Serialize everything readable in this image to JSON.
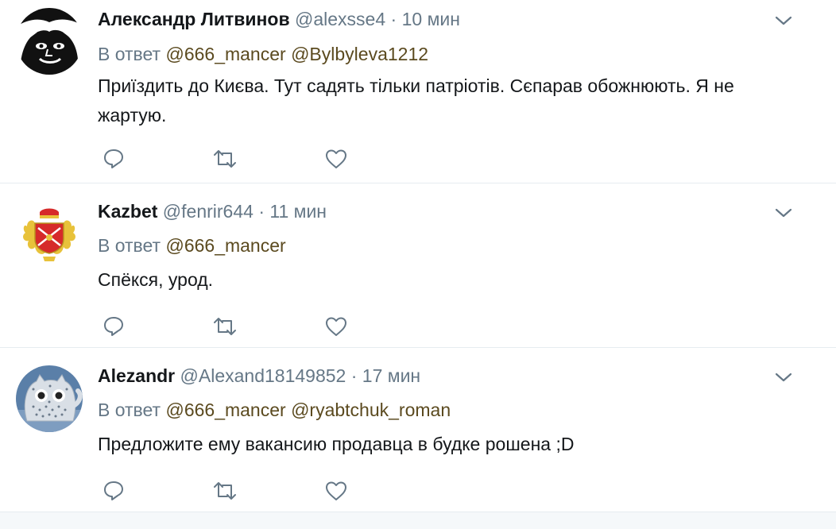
{
  "colors": {
    "name": "#14171a",
    "meta": "#657786",
    "mention": "#5b4a1f",
    "divider": "#e6ecf0"
  },
  "tweets": [
    {
      "fullname": "Александр Литвинов",
      "username": "@alexsse4",
      "separator": "·",
      "time": "10 мин",
      "reply_prefix": "В ответ",
      "mentions": [
        "@666_mancer",
        "@Bylbyleva1212"
      ],
      "text": "Приїздить до Києва. Тут садять тільки патріотів. Сєпарав обожнюють. Я не жартую.",
      "avatar_icon": "black-white-portrait-avatar"
    },
    {
      "fullname": "Kazbet",
      "username": "@fenrir644",
      "separator": "·",
      "time": "11 мин",
      "reply_prefix": "В ответ",
      "mentions": [
        "@666_mancer"
      ],
      "text": "Спёкся, урод.",
      "avatar_icon": "coat-of-arms-avatar"
    },
    {
      "fullname": "Alezandr",
      "username": "@Alexand18149852",
      "separator": "·",
      "time": "17 мин",
      "reply_prefix": "В ответ",
      "mentions": [
        "@666_mancer",
        "@ryabtchuk_roman"
      ],
      "text": "Предложите ему вакансию продавца в будке рошена ;D",
      "avatar_icon": "knitted-owl-avatar"
    }
  ],
  "icons": {
    "reply": "reply-icon",
    "retweet": "retweet-icon",
    "like": "heart-icon",
    "more": "chevron-down-icon"
  }
}
